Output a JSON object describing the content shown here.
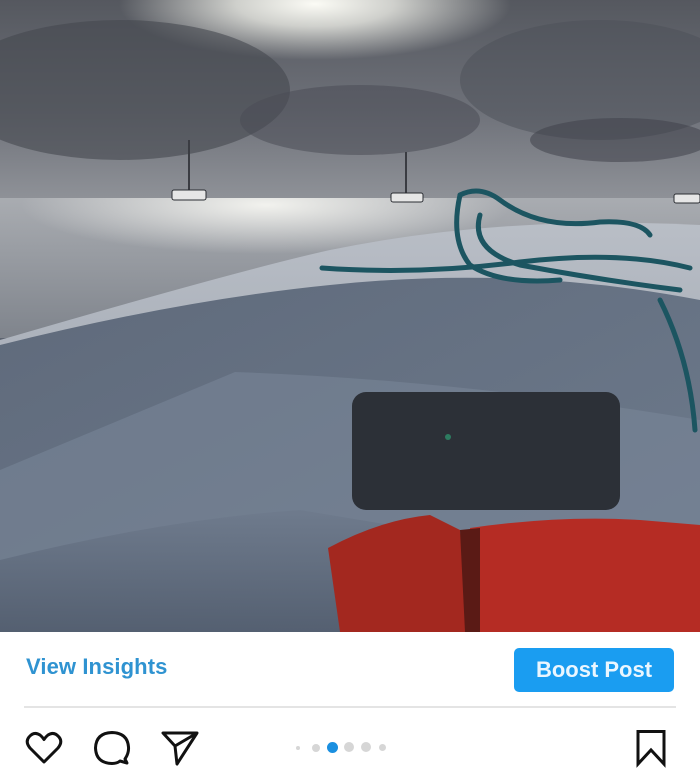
{
  "post": {
    "image": {
      "alt": "View from the bow of a white boat with a coiled teal rope and red life jackets, looking out over a silvery sea toward anchored catamarans under a cloudy sky",
      "dominant_colors": {
        "sky": "#6b6e75",
        "sea": "#9fa3aa",
        "hull": "#6a7484",
        "life_jacket": "#b8322a",
        "rope": "#1d5a66"
      }
    },
    "insights_link": "View Insights",
    "boost_button": "Boost Post",
    "accent_color": "#1a9df1",
    "link_color": "#2f93d1",
    "carousel": {
      "total_dots": 6,
      "active_index": 2,
      "active_color": "#1a8fe0",
      "inactive_color": "#d6d6d6"
    },
    "toolbar": {
      "like_icon": "heart-icon",
      "comment_icon": "comment-icon",
      "share_icon": "paper-plane-icon",
      "save_icon": "bookmark-icon"
    }
  }
}
